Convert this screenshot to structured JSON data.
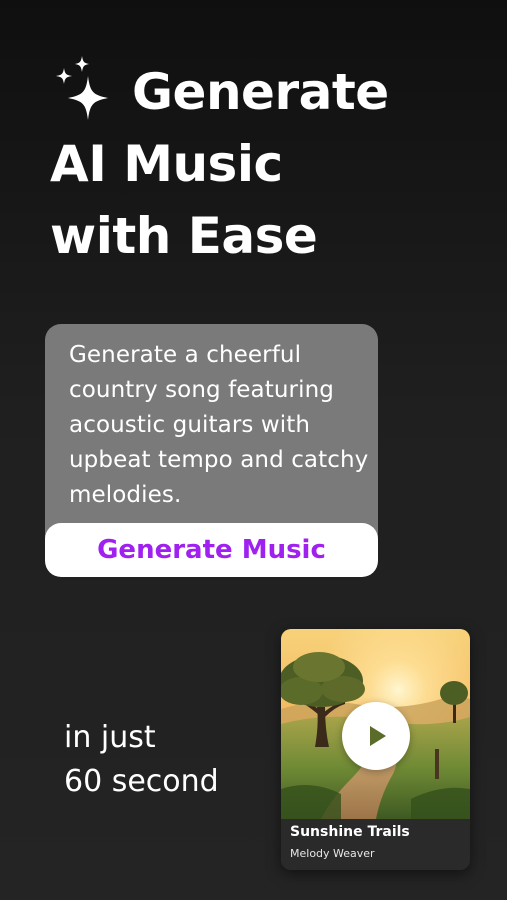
{
  "headline": {
    "line1": "Generate",
    "line2": "AI Music",
    "line3": "with Ease"
  },
  "prompt_card": {
    "prompt_text": "Generate a cheerful country song featuring acoustic guitars with upbeat tempo and catchy melodies.",
    "button_label": "Generate Music"
  },
  "tagline": {
    "line1": "in just",
    "line2": "60 second"
  },
  "song_card": {
    "title": "Sunshine Trails",
    "artist": "Melody Weaver",
    "artwork_icon": "landscape-artwork",
    "play_icon": "play-icon"
  },
  "colors": {
    "accent_purple": "#a020f0",
    "card_gray": "#7a7a7a",
    "background_dark": "#1a1a1a"
  },
  "icons": {
    "headline_icon": "sparkles-icon"
  }
}
